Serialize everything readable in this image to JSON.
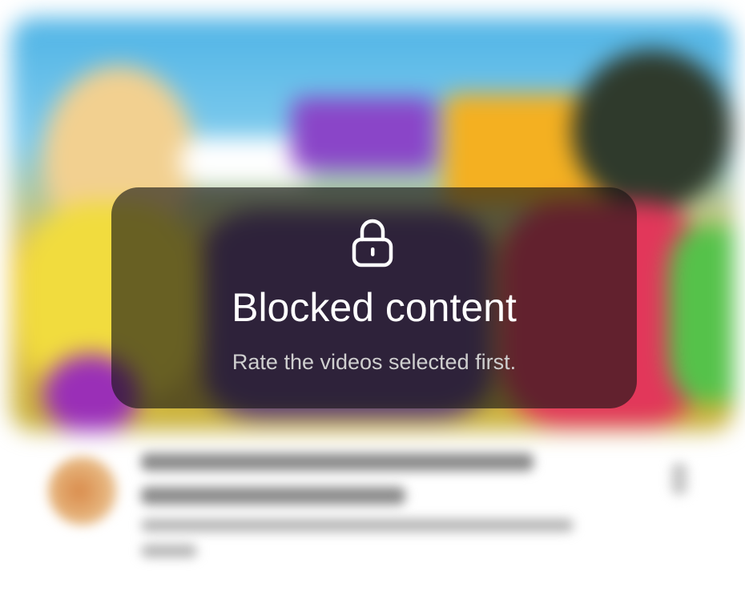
{
  "overlay": {
    "icon": "lock-icon",
    "title": "Blocked content",
    "message": "Rate the videos selected first."
  },
  "colors": {
    "overlay_bg": "#141414",
    "title_text": "#ffffff",
    "message_text": "#cfcfcf"
  }
}
